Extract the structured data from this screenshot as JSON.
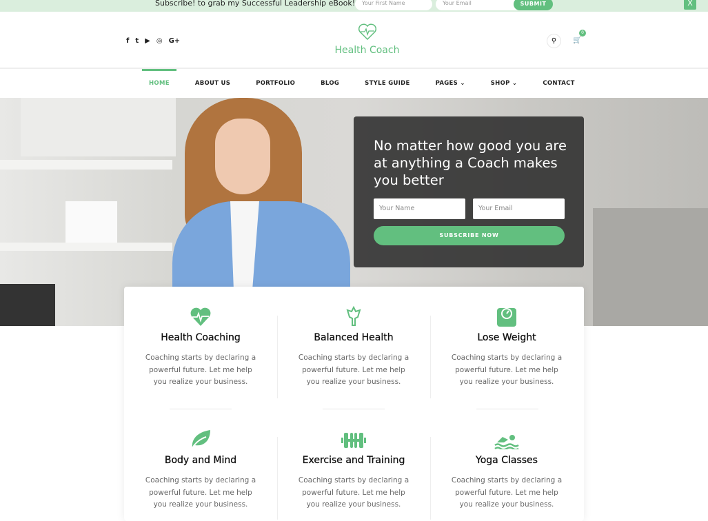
{
  "topbar": {
    "message": "Subscribe! to grab my Successful Leadership eBook!",
    "first_name_placeholder": "Your First Name",
    "email_placeholder": "Your Email",
    "submit": "SUBMIT",
    "close": "X"
  },
  "header": {
    "logo_text": "Health Coach",
    "social": [
      "f",
      "t",
      "▶",
      "◎",
      "G+"
    ],
    "cart_count": "0"
  },
  "nav": {
    "items": [
      "HOME",
      "ABOUT US",
      "PORTFOLIO",
      "BLOG",
      "STYLE GUIDE",
      "PAGES ⌄",
      "SHOP ⌄",
      "CONTACT"
    ],
    "active": "HOME"
  },
  "hero": {
    "headline": "No matter how good you are at anything a Coach makes you better",
    "name_placeholder": "Your Name",
    "email_placeholder": "Your Email",
    "button": "SUBSCRIBE NOW"
  },
  "features": [
    {
      "title": "Health Coaching",
      "text": "Coaching starts by declaring a powerful future. Let me help you realize your business.",
      "icon": "heart-pulse"
    },
    {
      "title": "Balanced Health",
      "text": "Coaching starts by declaring a powerful future. Let me help you realize your business.",
      "icon": "emblem"
    },
    {
      "title": "Lose Weight",
      "text": "Coaching starts by declaring a powerful future. Let me help you realize your business.",
      "icon": "scale"
    },
    {
      "title": "Body and Mind",
      "text": "Coaching starts by declaring a powerful future. Let me help you realize your business.",
      "icon": "leaf"
    },
    {
      "title": "Exercise and Training",
      "text": "Coaching starts by declaring a powerful future. Let me help you realize your business.",
      "icon": "dumbbell"
    },
    {
      "title": "Yoga Classes",
      "text": "Coaching starts by declaring a powerful future. Let me help you realize your business.",
      "icon": "swimmer"
    }
  ],
  "colors": {
    "accent": "#62bf7f"
  }
}
